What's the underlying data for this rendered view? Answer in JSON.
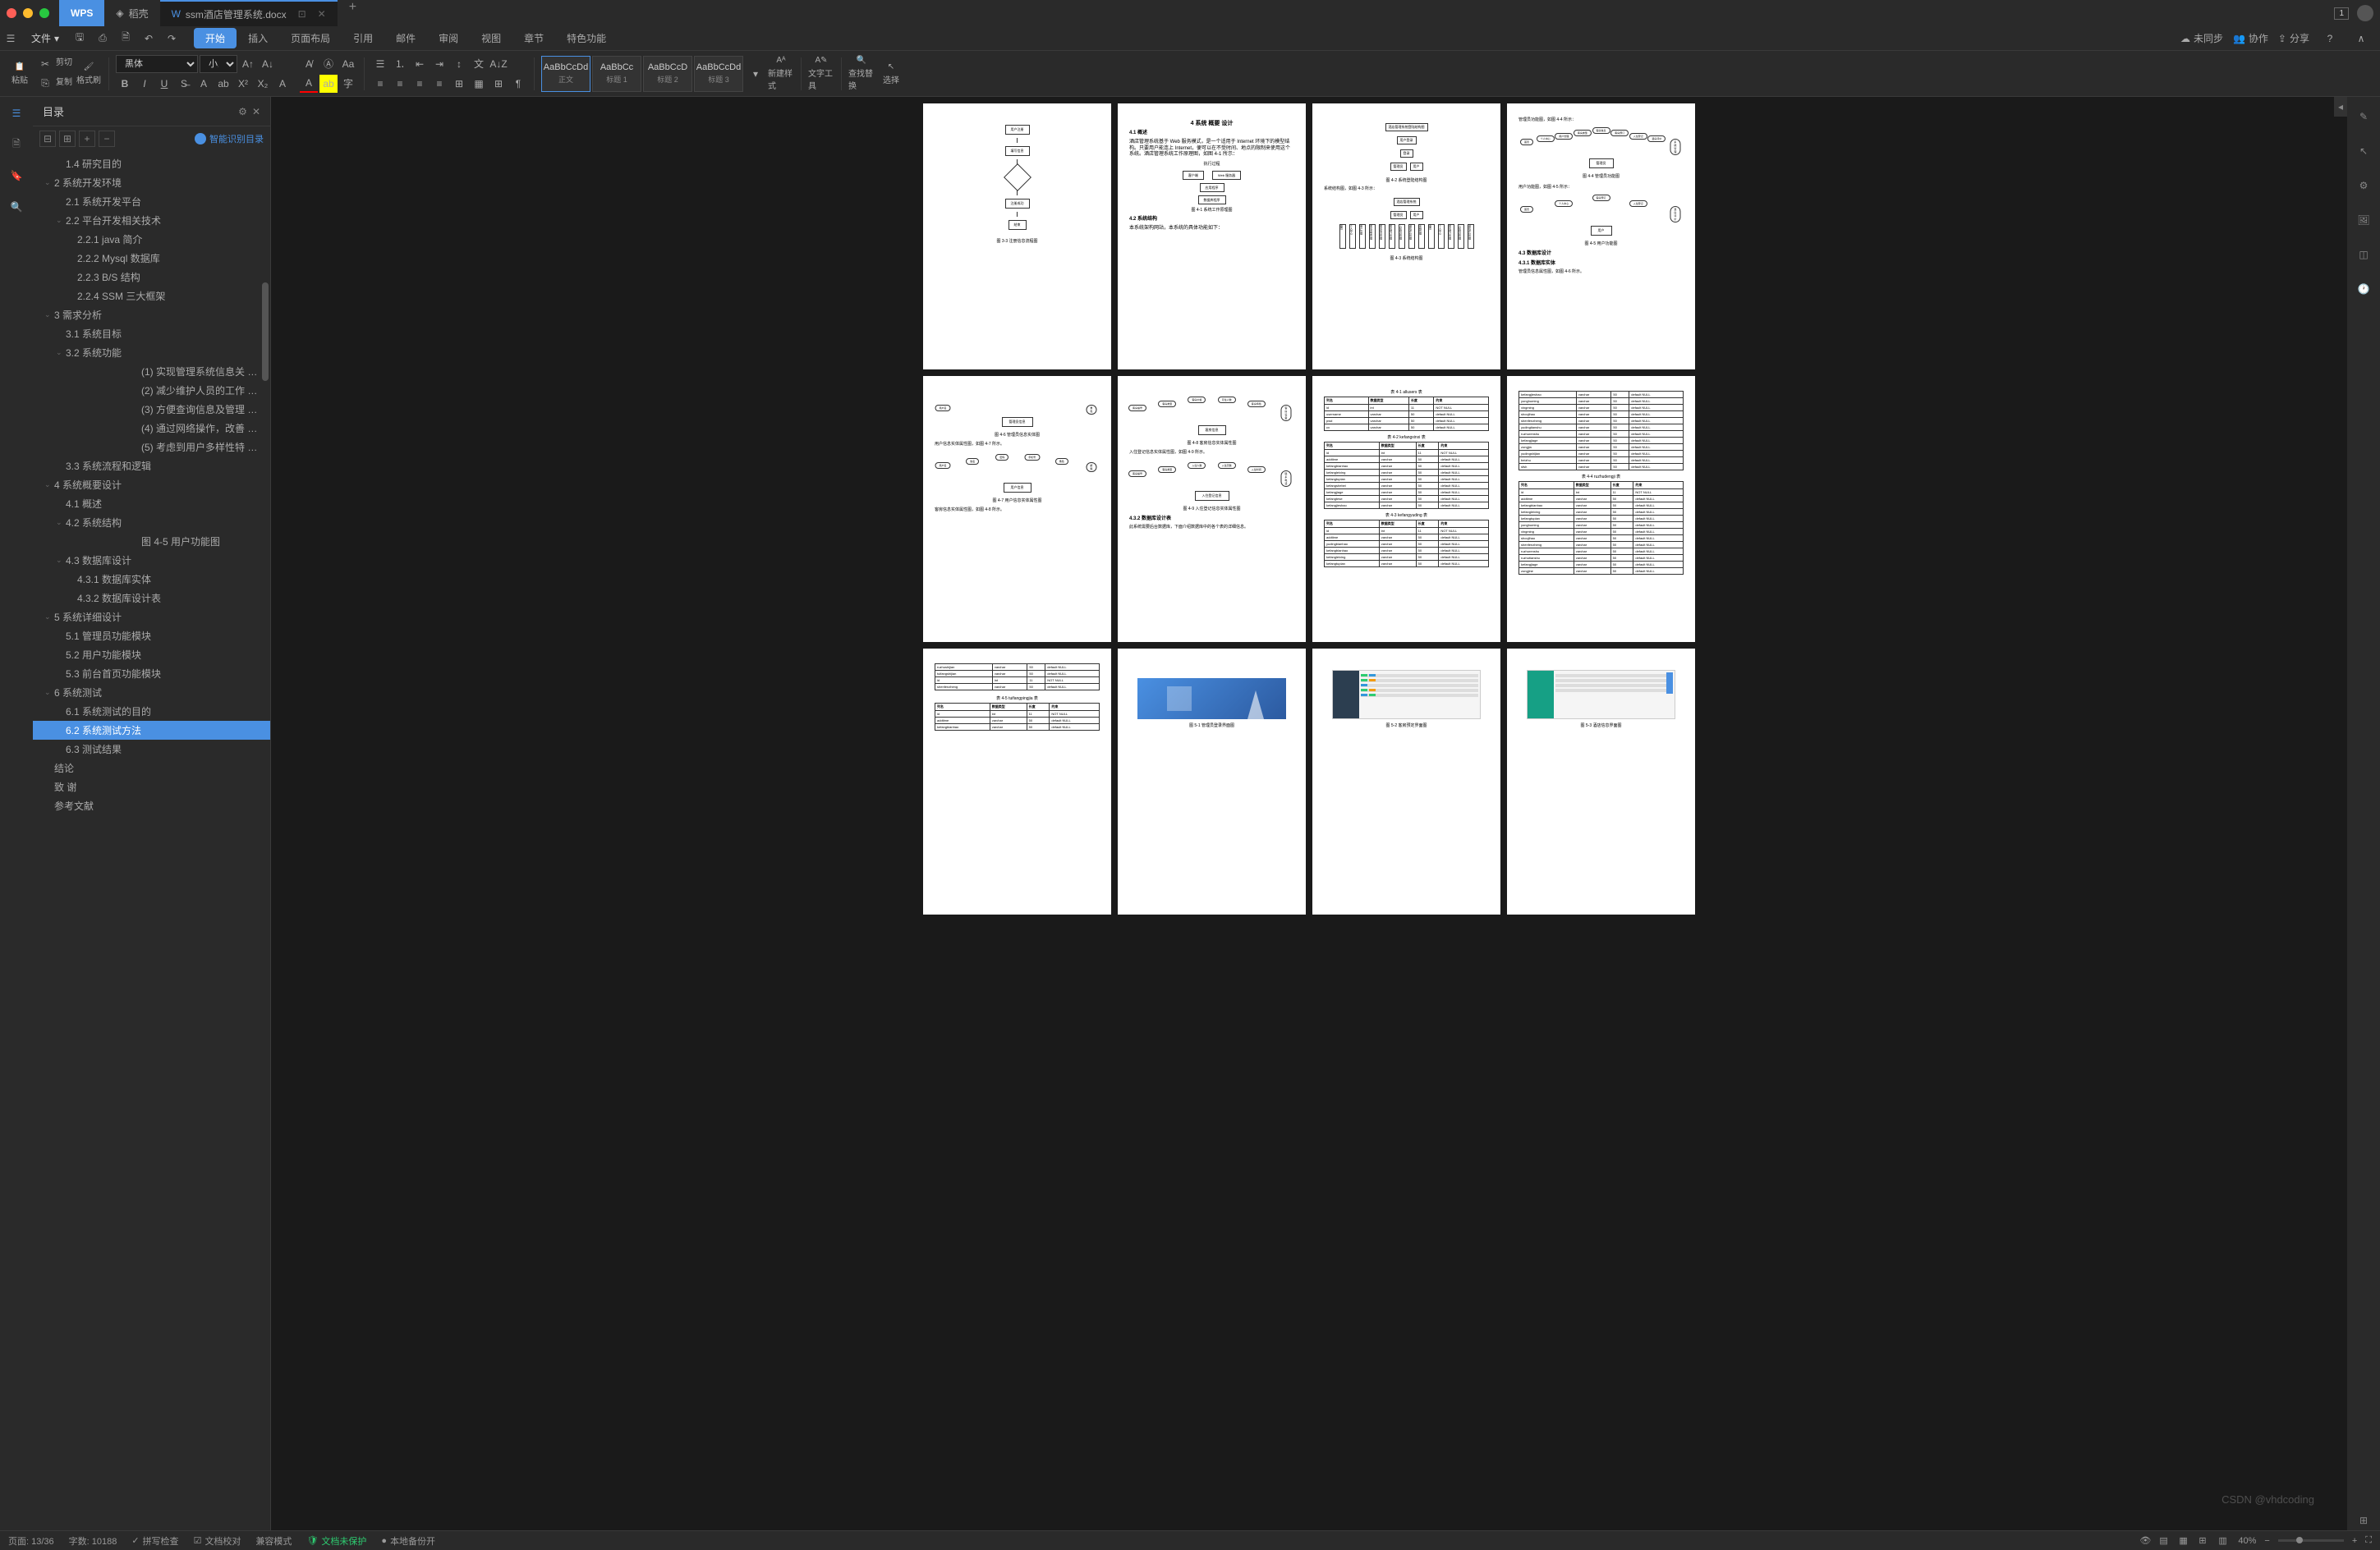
{
  "titlebar": {
    "wps_label": "WPS",
    "tabs": [
      {
        "icon": "doc",
        "label": "稻壳"
      },
      {
        "icon": "word",
        "label": "ssm酒店管理系统.docx",
        "active": true
      }
    ]
  },
  "menubar": {
    "file": "文件",
    "tabs": [
      "开始",
      "插入",
      "页面布局",
      "引用",
      "邮件",
      "审阅",
      "视图",
      "章节",
      "特色功能"
    ],
    "active_tab": "开始",
    "right": {
      "sync": "未同步",
      "collab": "协作",
      "share": "分享"
    }
  },
  "ribbon": {
    "paste": "粘贴",
    "cut": "剪切",
    "copy": "复制",
    "format_painter": "格式刷",
    "font_name": "黑体",
    "font_size": "小三",
    "styles": [
      {
        "preview": "AaBbCcDd",
        "label": "正文",
        "active": true
      },
      {
        "preview": "AaBbCc",
        "label": "标题 1"
      },
      {
        "preview": "AaBbCcD",
        "label": "标题 2"
      },
      {
        "preview": "AaBbCcDd",
        "label": "标题 3"
      }
    ],
    "new_style": "新建样式",
    "text_tools": "文字工具",
    "find_replace": "查找替换",
    "select": "选择"
  },
  "outline": {
    "title": "目录",
    "smart_toc": "智能识别目录",
    "items": [
      {
        "level": 2,
        "label": "1.4 研究目的"
      },
      {
        "level": 1,
        "label": "2 系统开发环境",
        "expandable": true,
        "expanded": true
      },
      {
        "level": 2,
        "label": "2.1  系统开发平台"
      },
      {
        "level": 2,
        "label": "2.2 平台开发相关技术",
        "expandable": true,
        "expanded": true
      },
      {
        "level": 3,
        "label": "2.2.1 java 简介"
      },
      {
        "level": 3,
        "label": "2.2.2 Mysql 数据库"
      },
      {
        "level": 3,
        "label": "2.2.3 B/S 结构"
      },
      {
        "level": 3,
        "label": "2.2.4 SSM 三大框架"
      },
      {
        "level": 1,
        "label": "3 需求分析",
        "expandable": true,
        "expanded": true
      },
      {
        "level": 2,
        "label": "3.1 系统目标"
      },
      {
        "level": 2,
        "label": "3.2 系统功能",
        "expandable": true,
        "expanded": true
      },
      {
        "level": 5,
        "label": "(1) 实现管理系统信息关 …"
      },
      {
        "level": 5,
        "label": "(2) 减少维护人员的工作 …"
      },
      {
        "level": 5,
        "label": "(3) 方便查询信息及管理 …"
      },
      {
        "level": 5,
        "label": "(4) 通过网络操作，改善 …"
      },
      {
        "level": 5,
        "label": "(5) 考虑到用户多样性特 …"
      },
      {
        "level": 2,
        "label": "3.3 系统流程和逻辑"
      },
      {
        "level": 1,
        "label": "4 系统概要设计",
        "expandable": true,
        "expanded": true
      },
      {
        "level": 2,
        "label": "4.1 概述"
      },
      {
        "level": 2,
        "label": "4.2  系统结构",
        "expandable": true,
        "expanded": true
      },
      {
        "level": 5,
        "label": "图 4-5  用户功能图"
      },
      {
        "level": 2,
        "label": "4.3 数据库设计",
        "expandable": true,
        "expanded": true
      },
      {
        "level": 3,
        "label": "4.3.1 数据库实体"
      },
      {
        "level": 3,
        "label": "4.3.2 数据库设计表"
      },
      {
        "level": 1,
        "label": "5 系统详细设计",
        "expandable": true,
        "expanded": true
      },
      {
        "level": 2,
        "label": "5.1 管理员功能模块"
      },
      {
        "level": 2,
        "label": "5.2 用户功能模块"
      },
      {
        "level": 2,
        "label": "5.3 前台首页功能模块"
      },
      {
        "level": 1,
        "label": "6 系统测试",
        "expandable": true,
        "expanded": true
      },
      {
        "level": 2,
        "label": "6.1 系统测试的目的"
      },
      {
        "level": 2,
        "label": "6.2 系统测试方法",
        "selected": true
      },
      {
        "level": 2,
        "label": "6.3 测试结果"
      },
      {
        "level": 1,
        "label": "结论"
      },
      {
        "level": 1,
        "label": "致    谢"
      },
      {
        "level": 1,
        "label": "参考文献"
      }
    ]
  },
  "pages": {
    "p1_caption": "图 3-3 注册信息流程图",
    "p2": {
      "title": "4 系统 概要 设计",
      "s1_title": "4.1 概述",
      "s1_text": "酒店管理系统基于 Web 服务模式，是一个适用于 Internet 环境下的模型结构。只要用户能连上 Internet，便可以在不受时间、地点的限制来使用这个系统。酒店管理系统工作原理图，如图 4-1 所示：",
      "exec_title": "执行过程",
      "exec_box1": "客户端",
      "exec_box2": "Web 服务器",
      "exec_box3": "应用程序",
      "exec_box4": "数据库程序",
      "exec_caption": "图 4-1 系统工作原理图",
      "s2_title": "4.2  系统结构",
      "s2_text": "本系统架构网站，本系统的具体功能如下："
    },
    "p3": {
      "top_title": "酒店管理系统登陆结构图",
      "box_users": "用户登录",
      "box_login": "登录",
      "box_admin": "管理员",
      "box_user": "用户",
      "caption1": "图 4-2 系统登陆结构图",
      "text1": "系统结构图，如图 4-3 所示：",
      "sys_title": "酒店管理系统",
      "node_admin": "管理员",
      "node_user": "用户",
      "leaves_admin": [
        "首页",
        "个人中心",
        "用户管理",
        "客房类型管理",
        "客房信息管理",
        "客房预订管理",
        "入住登记管理",
        "退房评价管理",
        "系统管理"
      ],
      "leaves_user": [
        "首页",
        "个人中心",
        "客房预订管理",
        "入住登记管理",
        "退房评价管理"
      ],
      "caption2": "图 4-3 系统结构图"
    },
    "p4": {
      "text1": "管理员功能图，如图 4-4 所示：",
      "center1": "管理员",
      "fan1": [
        "首页",
        "个人中心",
        "用户管理",
        "客房类型",
        "客房信息",
        "客房预订",
        "入住登记",
        "退房评价",
        "系统管理"
      ],
      "caption1": "图 4-4 管理员功能图",
      "text2": "用户功能图，如图 4-5 所示：",
      "center2": "用户",
      "fan2": [
        "首页",
        "个人中心",
        "客房预订",
        "入住登记",
        "退房评价"
      ],
      "caption2": "图 4-5 用户功能图",
      "s1_title": "4.3 数据库设计",
      "s2_title": "4.3.1 数据库实体",
      "text3": "管理员信息属性图，如图 4-6 所示。"
    },
    "p5": {
      "fan1_items": [
        "用户名",
        "角色"
      ],
      "center1": "管理员信息",
      "caption1": "图 4-6 管理员信息实体图",
      "text1": "用户信息实体属性图，如图 4-7 所示。",
      "fan2_items": [
        "用户名",
        "姓名",
        "密码",
        "手机号",
        "角色",
        "邮箱"
      ],
      "center2": "用户信息",
      "caption2": "图 4-7 用户信息实体属性图",
      "text2": "客房信息实体属性图，如图 4-8 所示。"
    },
    "p6": {
      "fan1_items": [
        "客房编号",
        "客房类型",
        "客房价格",
        "可住人数",
        "客房特色",
        "客房设备"
      ],
      "center1": "客房信息",
      "caption1": "图 4-8 客房信息实体属性图",
      "text1": "入住登记信息实体属性图，如图 4-9 所示。",
      "fan2_items": [
        "客房编号",
        "客房类型",
        "入住人数",
        "入住天数",
        "入住时间",
        "联系电话"
      ],
      "center2": "入住登记信息",
      "caption2": "图 4-9 入住登记信息实体属性图",
      "s_title": "4.3.2 数据库设计表",
      "text2": "此系统需要后台数据库，下面介绍数据库中的各个表的详细信息。"
    },
    "p7": {
      "t1_caption": "表 4-1 allusers 表",
      "headers": [
        "列名",
        "数据类型",
        "长度",
        "约束"
      ],
      "t1_rows": [
        [
          "id",
          "int",
          "11",
          "NOT NULL"
        ],
        [
          "username",
          "varchar",
          "50",
          "default NULL"
        ],
        [
          "pwd",
          "varchar",
          "50",
          "default NULL"
        ],
        [
          "cx",
          "varchar",
          "50",
          "default NULL"
        ]
      ],
      "t2_caption": "表 4-2 kefangxinxi 表",
      "t2_rows": [
        [
          "id",
          "int",
          "11",
          "NOT NULL"
        ],
        [
          "addtime",
          "varchar",
          "50",
          "default NULL"
        ],
        [
          "kefangbianhao",
          "varchar",
          "50",
          "default NULL"
        ],
        [
          "kefangleixing",
          "varchar",
          "50",
          "default NULL"
        ],
        [
          "kefangtupian",
          "varchar",
          "50",
          "default NULL"
        ],
        [
          "kefangshebei",
          "varchar",
          "50",
          "default NULL"
        ],
        [
          "kefangjiage",
          "varchar",
          "50",
          "default NULL"
        ],
        [
          "kefangtese",
          "varchar",
          "50",
          "default NULL"
        ],
        [
          "kefangjieshao",
          "varchar",
          "50",
          "default NULL"
        ]
      ],
      "t3_caption": "表 4-3 kefangyuding 表",
      "t3_rows": [
        [
          "id",
          "int",
          "11",
          "NOT NULL"
        ],
        [
          "addtime",
          "varchar",
          "50",
          "default NULL"
        ],
        [
          "yudingbianhao",
          "varchar",
          "50",
          "default NULL"
        ],
        [
          "kefangbianhao",
          "varchar",
          "50",
          "default NULL"
        ],
        [
          "kefangleixing",
          "varchar",
          "50",
          "default NULL"
        ],
        [
          "kefangtupian",
          "varchar",
          "50",
          "default NULL"
        ]
      ]
    },
    "p8": {
      "t1_rows": [
        [
          "kefangjieshao",
          "varchar",
          "50",
          "default NULL"
        ],
        [
          "yonghuming",
          "varchar",
          "50",
          "default NULL"
        ],
        [
          "xingming",
          "varchar",
          "50",
          "default NULL"
        ],
        [
          "shoujihao",
          "varchar",
          "50",
          "default NULL"
        ],
        [
          "shenfenzheng",
          "varchar",
          "50",
          "default NULL"
        ],
        [
          "yudingtianshu",
          "varchar",
          "50",
          "default NULL"
        ],
        [
          "ruzhurenshu",
          "varchar",
          "50",
          "default NULL"
        ],
        [
          "kefangjiage",
          "varchar",
          "50",
          "default NULL"
        ],
        [
          "zongjia",
          "varchar",
          "50",
          "default NULL"
        ],
        [
          "yudingshijian",
          "varchar",
          "50",
          "default NULL"
        ],
        [
          "beizhu",
          "varchar",
          "50",
          "default NULL"
        ],
        [
          "sfsh",
          "varchar",
          "50",
          "default NULL"
        ]
      ],
      "t2_caption": "表 4-4 ruzhudengji 表",
      "headers": [
        "列名",
        "数据类型",
        "长度",
        "约束"
      ],
      "t2_rows": [
        [
          "id",
          "int",
          "11",
          "NOT NULL"
        ],
        [
          "addtime",
          "varchar",
          "50",
          "default NULL"
        ],
        [
          "kefangbianhao",
          "varchar",
          "50",
          "default NULL"
        ],
        [
          "kefangleixing",
          "varchar",
          "50",
          "default NULL"
        ],
        [
          "kefangtupian",
          "varchar",
          "50",
          "default NULL"
        ],
        [
          "yonghuming",
          "varchar",
          "50",
          "default NULL"
        ],
        [
          "xingming",
          "varchar",
          "50",
          "default NULL"
        ],
        [
          "shoujihao",
          "varchar",
          "50",
          "default NULL"
        ],
        [
          "shenfenzheng",
          "varchar",
          "50",
          "default NULL"
        ],
        [
          "ruzhurenshu",
          "varchar",
          "50",
          "default NULL"
        ],
        [
          "ruzhutianshu",
          "varchar",
          "50",
          "default NULL"
        ],
        [
          "kefangjiage",
          "varchar",
          "50",
          "default NULL"
        ],
        [
          "zongjine",
          "varchar",
          "50",
          "default NULL"
        ]
      ]
    },
    "p9": {
      "t1_rows": [
        [
          "ruzhushijian",
          "varchar",
          "50",
          "default NULL"
        ],
        [
          "tuifangshijian",
          "varchar",
          "50",
          "default NULL"
        ],
        [
          "id",
          "int",
          "11",
          "NOT NULL"
        ],
        [
          "shenfenzheng",
          "varchar",
          "50",
          "default NULL"
        ]
      ],
      "t2_caption": "表 4-5 tuifangpingjia 表",
      "headers": [
        "列名",
        "数据类型",
        "长度",
        "约束"
      ],
      "t2_rows": [
        [
          "id",
          "int",
          "11",
          "NOT NULL"
        ],
        [
          "addtime",
          "varchar",
          "50",
          "default NULL"
        ],
        [
          "kefangbianhao",
          "varchar",
          "50",
          "default NULL"
        ]
      ]
    },
    "p10": {
      "caption": "图 5-1 管理员登录界面图"
    },
    "p11": {
      "caption": "图 5-2 客房预定界面图"
    },
    "p12": {
      "caption": "图 5-3 酒店信息界面图"
    }
  },
  "statusbar": {
    "page": "页面: 13/36",
    "words": "字数: 10188",
    "spellcheck": "拼写检查",
    "doc_check": "文档校对",
    "compat": "兼容模式",
    "protect": "文档未保护",
    "local_backup": "本地备份开",
    "zoom": "40%"
  },
  "watermark": "CSDN @vhdcoding"
}
